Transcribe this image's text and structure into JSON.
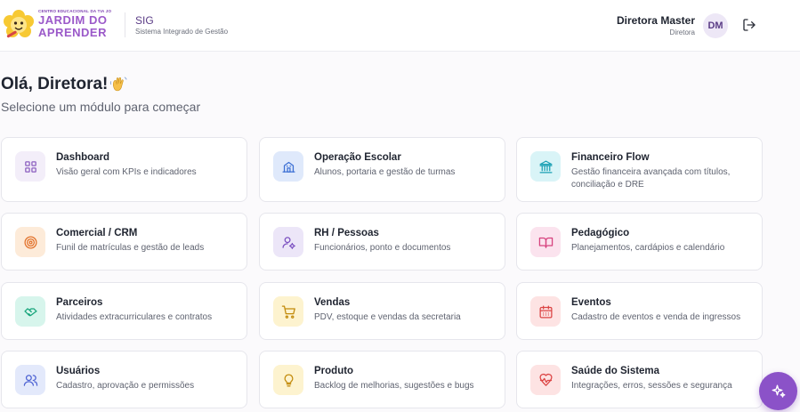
{
  "header": {
    "logo_small": "CENTRO EDUCACIONAL DA TIA JO",
    "logo_line1": "JARDIM DO",
    "logo_line2": "APRENDER",
    "system_name": "SIG",
    "system_full": "Sistema Integrado de Gestão",
    "user_name": "Diretora Master",
    "user_role": "Diretora",
    "avatar_initials": "DM",
    "logout_icon": "logout-icon"
  },
  "main": {
    "greeting": "Olá, Diretora!",
    "greeting_emoji": "waving-hand",
    "subtitle": "Selecione um módulo para começar"
  },
  "modules": [
    {
      "title": "Dashboard",
      "desc": "Visão geral com KPIs e indicadores",
      "icon": "grid-icon",
      "bg": "#f3eef9",
      "color": "#8b5fbf"
    },
    {
      "title": "Operação Escolar",
      "desc": "Alunos, portaria e gestão de turmas",
      "icon": "school-icon",
      "bg": "#dfe9fb",
      "color": "#3b6fd4"
    },
    {
      "title": "Financeiro Flow",
      "desc": "Gestão financeira avançada com títulos, conciliação e DRE",
      "icon": "bank-icon",
      "bg": "#d9f4f7",
      "color": "#1aa0b4"
    },
    {
      "title": "Comercial / CRM",
      "desc": "Funil de matrículas e gestão de leads",
      "icon": "target-icon",
      "bg": "#fdebd9",
      "color": "#e2722b"
    },
    {
      "title": "RH / Pessoas",
      "desc": "Funcionários, ponto e documentos",
      "icon": "user-cog-icon",
      "bg": "#ece6f8",
      "color": "#7a4fc0"
    },
    {
      "title": "Pedagógico",
      "desc": "Planejamentos, cardápios e calendário",
      "icon": "book-open-icon",
      "bg": "#fbe3ee",
      "color": "#d6427e"
    },
    {
      "title": "Parceiros",
      "desc": "Atividades extracurriculares e contratos",
      "icon": "handshake-icon",
      "bg": "#d7f5ec",
      "color": "#18a57b"
    },
    {
      "title": "Vendas",
      "desc": "PDV, estoque e vendas da secretaria",
      "icon": "cart-icon",
      "bg": "#fdf3cf",
      "color": "#c28a0a"
    },
    {
      "title": "Eventos",
      "desc": "Cadastro de eventos e venda de ingressos",
      "icon": "calendar-icon",
      "bg": "#fde3e3",
      "color": "#dc4545"
    },
    {
      "title": "Usuários",
      "desc": "Cadastro, aprovação e permissões",
      "icon": "users-icon",
      "bg": "#e3e9fb",
      "color": "#4e63d3"
    },
    {
      "title": "Produto",
      "desc": "Backlog de melhorias, sugestões e bugs",
      "icon": "lightbulb-icon",
      "bg": "#fdf3cf",
      "color": "#c28a0a"
    },
    {
      "title": "Saúde do Sistema",
      "desc": "Integrações, erros, sessões e segurança",
      "icon": "heart-pulse-icon",
      "bg": "#fde3e3",
      "color": "#dc4545"
    }
  ],
  "fab": {
    "icon": "sparkles-icon",
    "color": "#8b52c8"
  }
}
